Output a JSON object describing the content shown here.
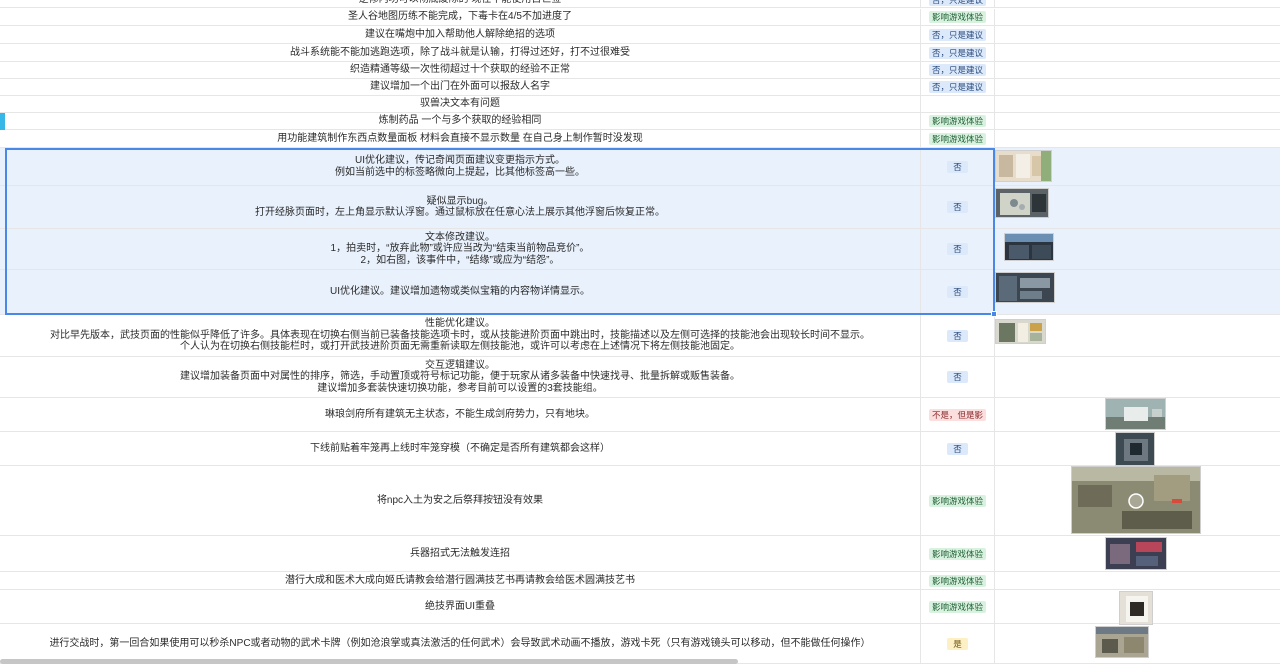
{
  "rows": [
    {
      "lines": [
        "逆修内功可以彻底废除的 现在不能使用古世签"
      ],
      "tag": "否，只是建议",
      "tag_color": "blue"
    },
    {
      "lines": [
        "圣人谷地图历练不能完成，下毒卡在4/5不加进度了"
      ],
      "tag": "影响游戏体验",
      "tag_color": "green"
    },
    {
      "lines": [
        "建议在嘴炮中加入帮助他人解除绝招的选项"
      ],
      "tag": "否，只是建议",
      "tag_color": "blue"
    },
    {
      "lines": [
        "战斗系统能不能加逃跑选项，除了战斗就是认输，打得过还好，打不过很难受"
      ],
      "tag": "否，只是建议",
      "tag_color": "blue"
    },
    {
      "lines": [
        "织造精通等级一次性彻超过十个获取的经验不正常"
      ],
      "tag": "否，只是建议",
      "tag_color": "blue"
    },
    {
      "lines": [
        "建议增加一个出门在外面可以报敌人名字"
      ],
      "tag": "否，只是建议",
      "tag_color": "blue"
    },
    {
      "lines": [
        "驭兽决文本有问题"
      ],
      "tag": "",
      "tag_color": ""
    },
    {
      "lines": [
        "炼制药品 一个与多个获取的经验相同"
      ],
      "tag": "影响游戏体验",
      "tag_color": "green"
    },
    {
      "lines": [
        "用功能建筑制作东西点数量面板 材料会直接不显示数量 在自己身上制作暂时没发现"
      ],
      "tag": "影响游戏体验",
      "tag_color": "green"
    },
    {
      "lines": [
        "UI优化建议，传记奇闻页面建议变更指示方式。",
        "例如当前选中的标签略微向上提起，比其他标签高一些。"
      ],
      "tag": "否",
      "tag_color": "blue"
    },
    {
      "lines": [
        "疑似显示bug。",
        "打开经脉页面时，左上角显示默认浮窗。通过鼠标放在任意心法上展示其他浮窗后恢复正常。"
      ],
      "tag": "否",
      "tag_color": "blue"
    },
    {
      "lines": [
        "文本修改建议。",
        "1，拍卖时，“放弃此物”或许应当改为“结束当前物品竞价”。",
        "2，如右图，该事件中，“结缘”或应为“结怨”。"
      ],
      "tag": "否",
      "tag_color": "blue"
    },
    {
      "lines": [
        "UI优化建议。建议增加遗物或类似宝箱的内容物详情显示。"
      ],
      "tag": "否",
      "tag_color": "blue"
    },
    {
      "lines": [
        "性能优化建议。",
        "对比早先版本，武技页面的性能似乎降低了许多。具体表现在切换右侧当前已装备技能选项卡时，或从技能进阶页面中跳出时，技能描述以及左侧可选择的技能池会出现较长时间不显示。",
        "个人认为在切换右侧技能栏时，或打开武技进阶页面无需重新读取左侧技能池，或许可以考虑在上述情况下将左侧技能池固定。"
      ],
      "tag": "否",
      "tag_color": "blue"
    },
    {
      "lines": [
        "交互逻辑建议。",
        "建议增加装备页面中对属性的排序，筛选，手动置顶或符号标记功能，便于玩家从诸多装备中快速找寻、批量拆解或贩售装备。",
        "建议增加多套装快速切换功能，参考目前可以设置的3套技能组。"
      ],
      "tag": "否",
      "tag_color": "blue"
    },
    {
      "lines": [
        "琳琅剑府所有建筑无主状态，不能生成剑府势力，只有地块。"
      ],
      "tag": "不是，但是影",
      "tag_color": "red"
    },
    {
      "lines": [
        "下线前贴着牢笼再上线时牢笼穿模（不确定是否所有建筑都会这样）"
      ],
      "tag": "否",
      "tag_color": "blue"
    },
    {
      "lines": [
        "将npc入土为安之后祭拜按钮没有效果"
      ],
      "tag": "影响游戏体验",
      "tag_color": "green"
    },
    {
      "lines": [
        "兵器招式无法触发连招"
      ],
      "tag": "影响游戏体验",
      "tag_color": "green"
    },
    {
      "lines": [
        "潜行大成和医术大成向姬氏请教会给潜行圆满技艺书再请教会给医术圆满技艺书"
      ],
      "tag": "影响游戏体验",
      "tag_color": "green"
    },
    {
      "lines": [
        "绝技界面UI重叠"
      ],
      "tag": "影响游戏体验",
      "tag_color": "green"
    },
    {
      "lines": [
        "进行交战时，第一回合如果使用可以秒杀NPC或者动物的武术卡牌（例如沧浪掌或真法激活的任何武术）会导致武术动画不播放，游戏卡死（只有游戏镜头可以移动，但不能做任何操作）"
      ],
      "tag": "是",
      "tag_color": "yellow"
    }
  ],
  "thumbnails": [
    {
      "row": 9,
      "name": "journal-screenshot"
    },
    {
      "row": 10,
      "name": "meridian-screenshot"
    },
    {
      "row": 11,
      "name": "auction-screenshot"
    },
    {
      "row": 12,
      "name": "relic-screenshot"
    },
    {
      "row": 13,
      "name": "skills-screenshot"
    },
    {
      "row": 15,
      "name": "sword-manor-screenshot"
    },
    {
      "row": 16,
      "name": "cage-screenshot"
    },
    {
      "row": 17,
      "name": "burial-video-screenshot"
    },
    {
      "row": 18,
      "name": "combo-screenshot"
    },
    {
      "row": 20,
      "name": "ultimate-ui-screenshot"
    },
    {
      "row": 21,
      "name": "battle-screenshot"
    }
  ]
}
